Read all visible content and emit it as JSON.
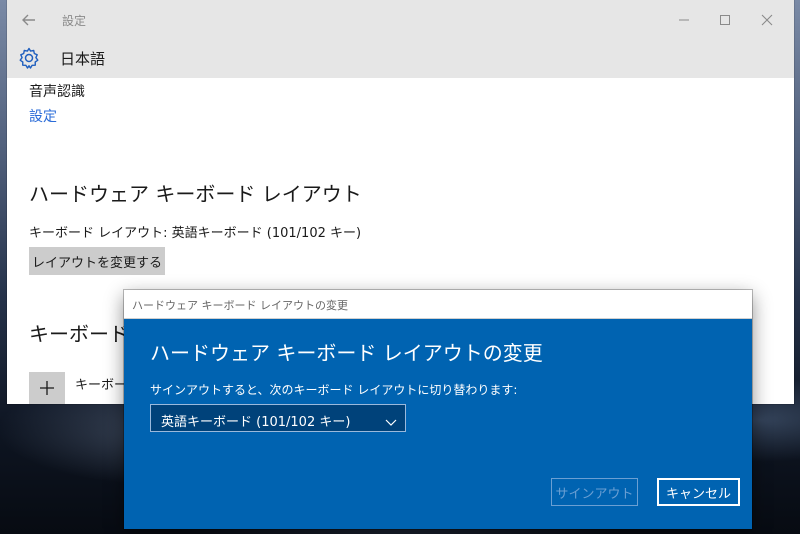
{
  "window": {
    "title": "設定"
  },
  "header": {
    "title": "日本語"
  },
  "speech": {
    "label": "音声認識",
    "settings_link": "設定"
  },
  "hardware_layout": {
    "title": "ハードウェア キーボード レイアウト",
    "current_layout": "キーボード レイアウト: 英語キーボード (101/102 キー)",
    "change_button": "レイアウトを変更する"
  },
  "keyboards": {
    "title": "キーボード",
    "add_label": "キーボード"
  },
  "dialog": {
    "titlebar": "ハードウェア キーボード レイアウトの変更",
    "heading": "ハードウェア キーボード レイアウトの変更",
    "description": "サインアウトすると、次のキーボード レイアウトに切り替わります:",
    "select_value": "英語キーボード (101/102 キー)",
    "signout_button": "サインアウト",
    "cancel_button": "キャンセル"
  },
  "icons": {
    "back": "back-arrow-icon",
    "settings": "gear-icon",
    "minimize": "minimize-icon",
    "maximize": "maximize-icon",
    "close": "close-icon",
    "add": "plus-icon",
    "dropdown": "chevron-down-icon"
  },
  "colors": {
    "accent": "#0063b1",
    "link": "#2b6cd8",
    "titlebar": "#e6e6e6"
  }
}
